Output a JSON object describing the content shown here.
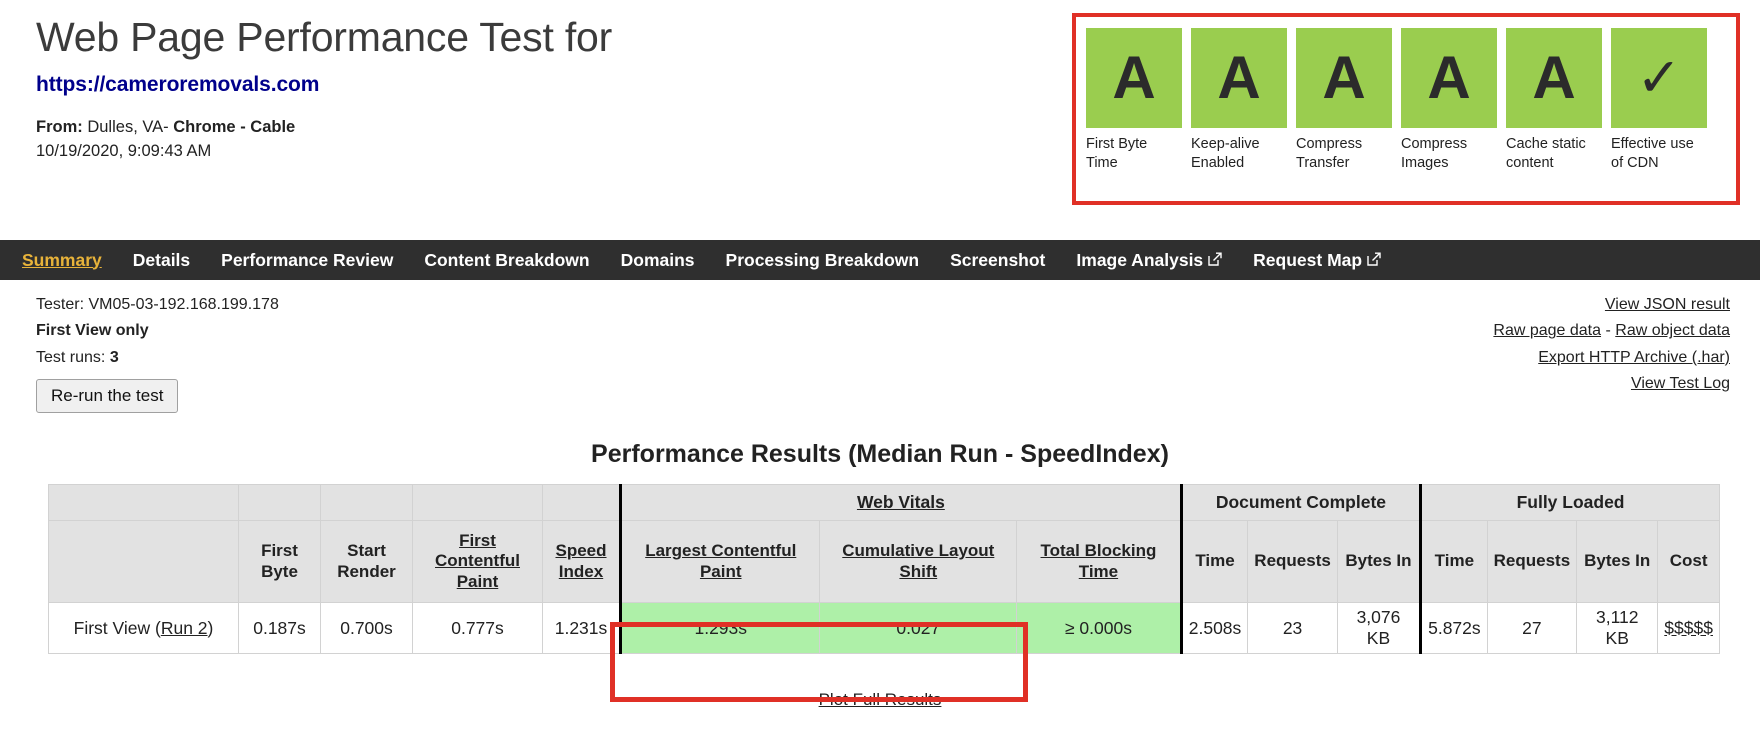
{
  "header": {
    "title": "Web Page Performance Test for",
    "url": "https://cameroremovals.com",
    "from_label": "From:",
    "from_location": "Dulles, VA",
    "from_sep1": "-",
    "from_browser": "Chrome",
    "from_sep2": "-",
    "from_connection": "Cable",
    "datetime": "10/19/2020, 9:09:43 AM"
  },
  "grades": {
    "accent_red": "#e03026",
    "box_green": "#9ACD4F",
    "items": [
      {
        "grade": "A",
        "label": "First Byte Time"
      },
      {
        "grade": "A",
        "label": "Keep-alive Enabled"
      },
      {
        "grade": "A",
        "label": "Compress Transfer"
      },
      {
        "grade": "A",
        "label": "Compress Images"
      },
      {
        "grade": "A",
        "label": "Cache static content"
      },
      {
        "grade": "✓",
        "label": "Effective use of CDN"
      }
    ]
  },
  "nav": {
    "active_color": "#E8B33A",
    "bar_color": "#2f2f2f",
    "items": [
      {
        "label": "Summary",
        "active": true,
        "external": false
      },
      {
        "label": "Details",
        "active": false,
        "external": false
      },
      {
        "label": "Performance Review",
        "active": false,
        "external": false
      },
      {
        "label": "Content Breakdown",
        "active": false,
        "external": false
      },
      {
        "label": "Domains",
        "active": false,
        "external": false
      },
      {
        "label": "Processing Breakdown",
        "active": false,
        "external": false
      },
      {
        "label": "Screenshot",
        "active": false,
        "external": false
      },
      {
        "label": "Image Analysis",
        "active": false,
        "external": true
      },
      {
        "label": "Request Map",
        "active": false,
        "external": true
      }
    ]
  },
  "info": {
    "tester_label": "Tester:",
    "tester_value": "VM05-03-192.168.199.178",
    "view_mode": "First View only",
    "test_runs_label": "Test runs:",
    "test_runs_value": "3",
    "rerun_button": "Re-run the test",
    "links": {
      "view_json": "View JSON result",
      "raw_page_data": "Raw page data",
      "raw_sep": "-",
      "raw_object_data": "Raw object data",
      "export_har": "Export HTTP Archive (.har)",
      "view_test_log": "View Test Log"
    }
  },
  "results": {
    "title": "Performance Results (Median Run - SpeedIndex)",
    "plot_link": "Plot Full Results",
    "highlight_green": "#AEF0A8",
    "group_headers": [
      {
        "label": "Web Vitals",
        "span": 3,
        "link": true
      },
      {
        "label": "Document Complete",
        "span": 3,
        "link": false
      },
      {
        "label": "Fully Loaded",
        "span": 4,
        "link": false
      }
    ],
    "columns": [
      {
        "label": "First Byte",
        "link": false
      },
      {
        "label": "Start Render",
        "link": false
      },
      {
        "label": "First Contentful Paint",
        "link": true
      },
      {
        "label": "Speed Index",
        "link": true
      },
      {
        "label": "Largest Contentful Paint",
        "link": true
      },
      {
        "label": "Cumulative Layout Shift",
        "link": true
      },
      {
        "label": "Total Blocking Time",
        "link": true
      },
      {
        "label": "Time",
        "link": false
      },
      {
        "label": "Requests",
        "link": false
      },
      {
        "label": "Bytes In",
        "link": false
      },
      {
        "label": "Time",
        "link": false
      },
      {
        "label": "Requests",
        "link": false
      },
      {
        "label": "Bytes In",
        "link": false
      },
      {
        "label": "Cost",
        "link": false
      }
    ],
    "row": {
      "label_prefix": "First View (",
      "label_link": "Run 2",
      "label_suffix": ")",
      "first_byte": "0.187s",
      "start_render": "0.700s",
      "first_contentful_paint": "0.777s",
      "speed_index": "1.231s",
      "largest_contentful_paint": "1.293s",
      "cumulative_layout_shift": "0.027",
      "total_blocking_time": "≥ 0.000s",
      "dc_time": "2.508s",
      "dc_requests": "23",
      "dc_bytes_in": "3,076 KB",
      "fl_time": "5.872s",
      "fl_requests": "27",
      "fl_bytes_in": "3,112 KB",
      "cost": "$$$$$"
    }
  }
}
